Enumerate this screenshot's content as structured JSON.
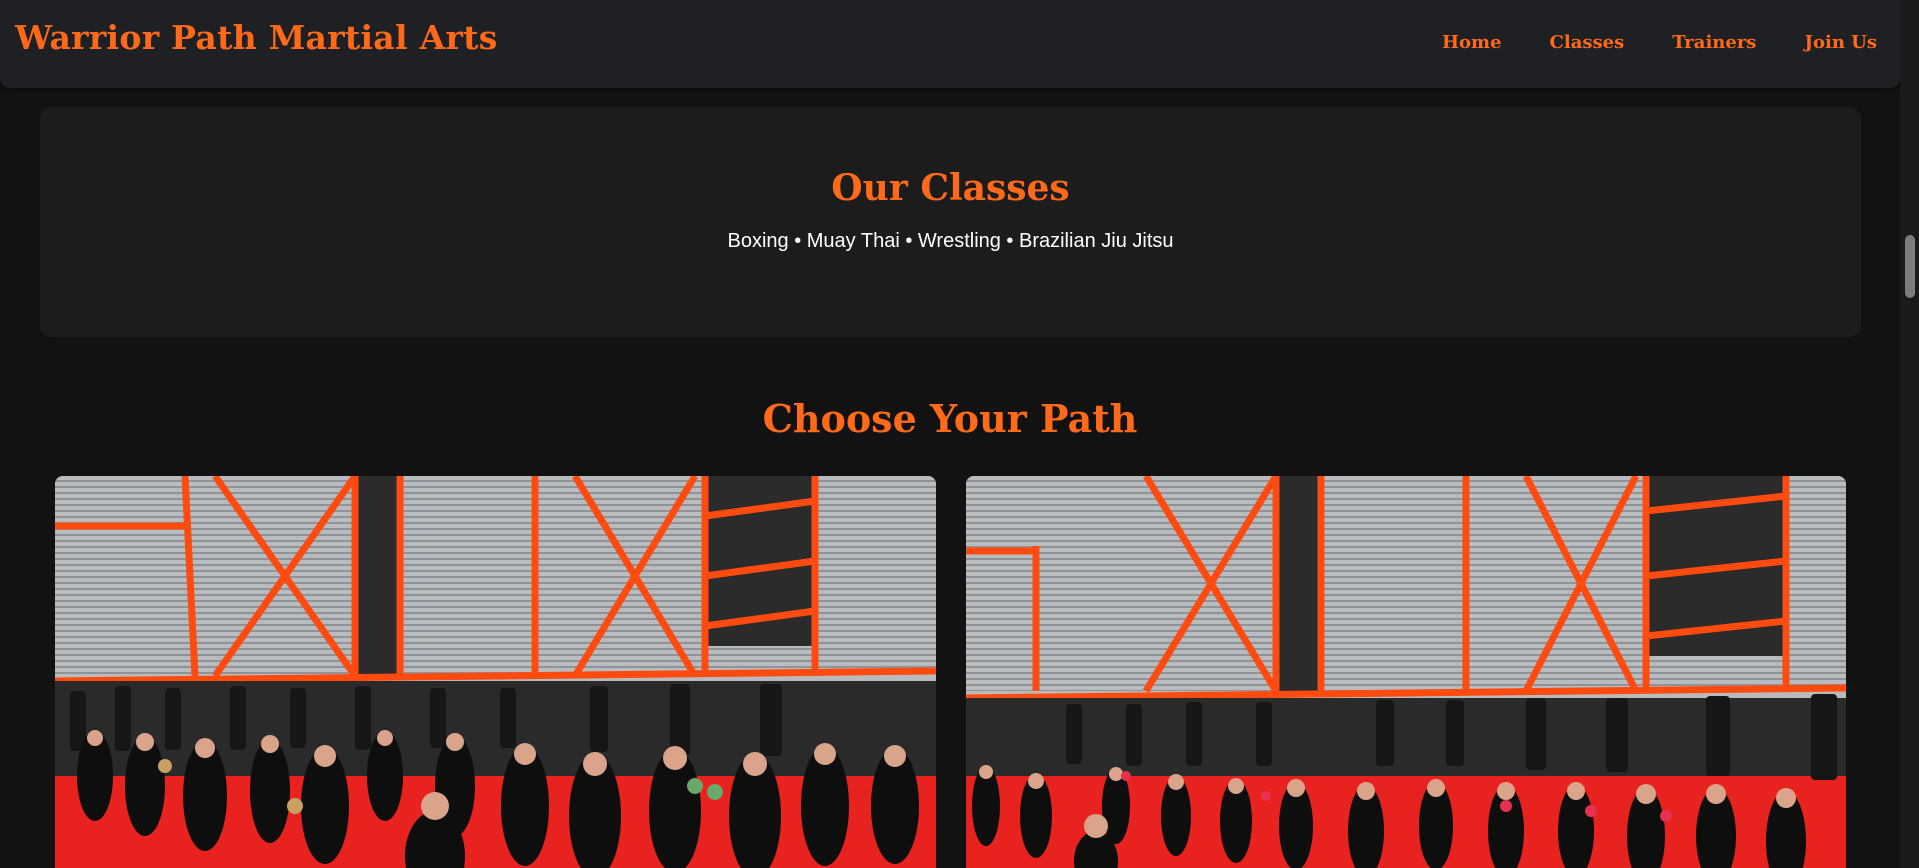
{
  "header": {
    "brand": "Warrior Path Martial Arts",
    "nav": [
      {
        "label": "Home"
      },
      {
        "label": "Classes"
      },
      {
        "label": "Trainers"
      },
      {
        "label": "Join Us"
      }
    ]
  },
  "classes": {
    "title": "Our Classes",
    "list": "Boxing • Muay Thai • Wrestling • Brazilian Jiu Jitsu"
  },
  "paths": {
    "title": "Choose Your Path",
    "photos": [
      {
        "icon": "gym-photo-adults"
      },
      {
        "icon": "gym-photo-kids"
      }
    ]
  },
  "colors": {
    "accent": "#ff6a1a",
    "background": "#121212",
    "navbar": "#1f2023",
    "card": "#1c1c1c",
    "mat": "#e8231f",
    "beam": "#ff4a10"
  }
}
